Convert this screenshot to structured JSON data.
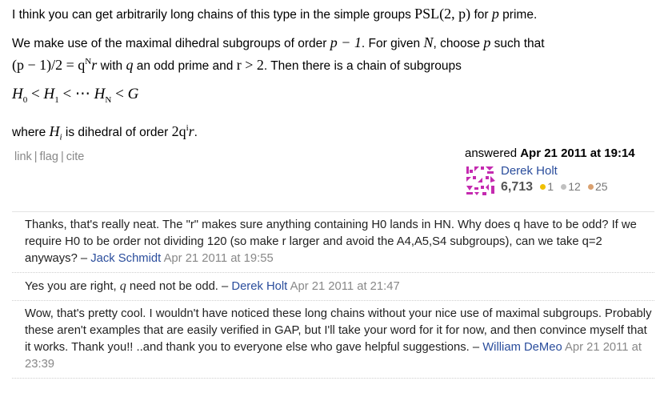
{
  "answer": {
    "p1_text": "I think you can get arbitrarily long chains of this type in the simple groups ",
    "p1_math": "PSL(2, p)",
    "p1_for": " for ",
    "p1_p": "p",
    "p1_end": " prime.",
    "p2_a": "We make use of the maximal dihedral subgroups of order ",
    "p2_math1": "p − 1",
    "p2_b": ". For given ",
    "p2_N": "N",
    "p2_c": ", choose ",
    "p2_p": "p",
    "p2_d": " such that",
    "p2_math2": "(p − 1)/2 = q",
    "p2_math2_sup": "N",
    "p2_math2_r": "r",
    "p2_e": " with ",
    "p2_q": "q",
    "p2_f": " an odd prime and ",
    "p2_math3": "r > 2",
    "p2_g": ". Then there is a chain of subgroups",
    "display_H0": "H",
    "display_H0_sub": "0",
    "display_lt1": " < ",
    "display_H1": "H",
    "display_H1_sub": "1",
    "display_lt2": " < ⋯ ",
    "display_HN": "H",
    "display_HN_sub": "N",
    "display_lt3": " < ",
    "display_G": "G",
    "p3_a": "where ",
    "p3_H": "H",
    "p3_H_sub": "i",
    "p3_b": " is dihedral of order ",
    "p3_math": "2q",
    "p3_math_sup": "i",
    "p3_math_r": "r",
    "p3_end": "."
  },
  "post_menu": {
    "link": "link",
    "flag": "flag",
    "cite": "cite",
    "sep": "|"
  },
  "user_card": {
    "action": "answered",
    "date": "Apr 21 2011 at 19:14",
    "name": "Derek Holt",
    "reputation": "6,713",
    "gold": "1",
    "silver": "12",
    "bronze": "25",
    "colors": {
      "gold": "#f0c000",
      "silver": "#c0c0c0",
      "bronze": "#d9a070",
      "gravatar": "#c42ab0",
      "link": "#2a4d9c"
    },
    "gravatar_icon": "identicon-icon"
  },
  "comments": [
    {
      "text": "Thanks, that's really neat. The \"r\" makes sure anything containing H0 lands in HN. Why does q have to be odd? If we require H0 to be order not dividing 120 (so make r larger and avoid the A4,A5,S4 subgroups), can we take q=2 anyways?",
      "dash": " – ",
      "user": "Jack Schmidt",
      "date": "Apr 21 2011 at 19:55"
    },
    {
      "text_a": "Yes you are right, ",
      "text_q": "q",
      "text_b": " need not be odd.",
      "dash": " – ",
      "user": "Derek Holt",
      "date": "Apr 21 2011 at 21:47"
    },
    {
      "text": "Wow, that's pretty cool. I wouldn't have noticed these long chains without your nice use of maximal subgroups. Probably these aren't examples that are easily verified in GAP, but I'll take your word for it for now, and then convince myself that it works. Thank you!! ..and thank you to everyone else who gave helpful suggestions.",
      "dash": " – ",
      "user": "William DeMeo",
      "date": "Apr 21 2011 at 23:39"
    }
  ]
}
